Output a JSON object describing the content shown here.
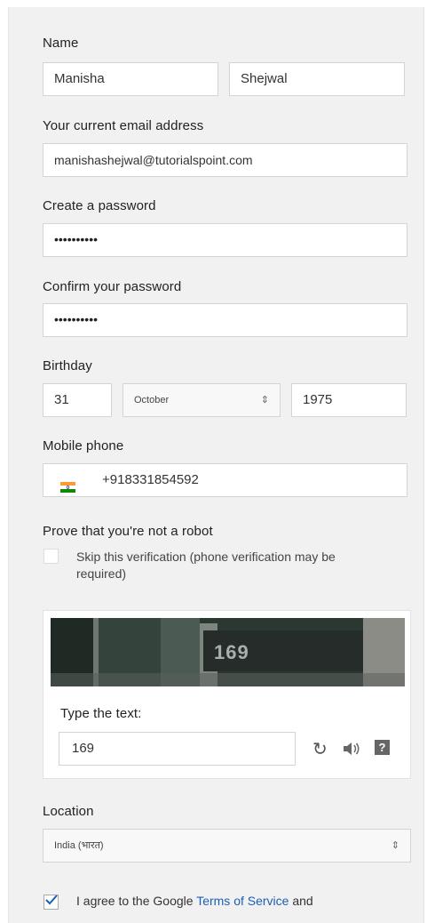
{
  "form": {
    "name_label": "Name",
    "first_name_value": "Manisha",
    "last_name_value": "Shejwal",
    "email_label": "Your current email address",
    "email_value": "manishashejwal@tutorialspoint.com",
    "password_label": "Create a password",
    "password_value": "••••••••••",
    "confirm_label": "Confirm your password",
    "confirm_value": "••••••••••",
    "birthday_label": "Birthday",
    "birthday_day": "31",
    "birthday_month": "October",
    "birthday_year": "1975",
    "mobile_label": "Mobile phone",
    "mobile_value": "+918331854592",
    "mobile_flag_icon": "india-flag-icon",
    "robot_label": "Prove that you're not a robot",
    "skip_line1": "Skip this verification (phone verification may be",
    "skip_line2": "required)",
    "captcha": {
      "image_text": "169",
      "type_label": "Type the text:",
      "input_value": "169",
      "icons": [
        "refresh-icon",
        "audio-icon",
        "help-icon"
      ]
    },
    "location_label": "Location",
    "location_value": "India (भारत)",
    "agree_prefix": "I agree to the Google ",
    "agree_link": "Terms of Service",
    "agree_suffix": " and",
    "agree_checked": true
  },
  "colors": {
    "card_bg": "#f1f1f1",
    "link": "#1a5fb4",
    "check": "#1a5fb4"
  }
}
